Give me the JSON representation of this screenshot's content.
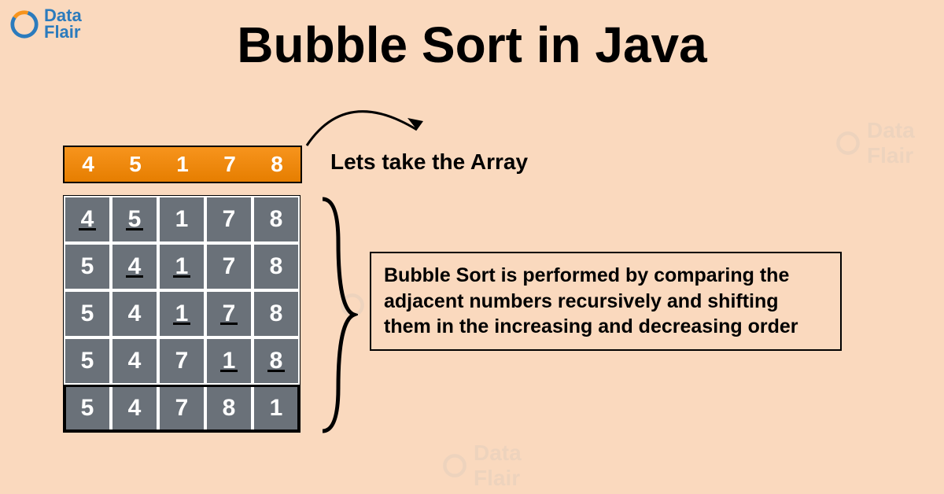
{
  "logo": {
    "line1": "Data",
    "line2": "Flair"
  },
  "title": "Bubble Sort in Java",
  "array_label": "Lets take the Array",
  "initial_array": [
    "4",
    "5",
    "1",
    "7",
    "8"
  ],
  "passes": [
    {
      "values": [
        "4",
        "5",
        "1",
        "7",
        "8"
      ],
      "underline": [
        0,
        1
      ]
    },
    {
      "values": [
        "5",
        "4",
        "1",
        "7",
        "8"
      ],
      "underline": [
        1,
        2
      ]
    },
    {
      "values": [
        "5",
        "4",
        "1",
        "7",
        "8"
      ],
      "underline": [
        2,
        3
      ]
    },
    {
      "values": [
        "5",
        "4",
        "7",
        "1",
        "8"
      ],
      "underline": [
        3,
        4
      ]
    },
    {
      "values": [
        "5",
        "4",
        "7",
        "8",
        "1"
      ],
      "underline": []
    }
  ],
  "explanation": "Bubble Sort is performed by comparing the adjacent numbers recursively and shifting them in the increasing and decreasing order",
  "colors": {
    "bg": "#fad9be",
    "orange": "#f7941d",
    "grid": "#6a7179",
    "brand": "#2b7bbd"
  }
}
